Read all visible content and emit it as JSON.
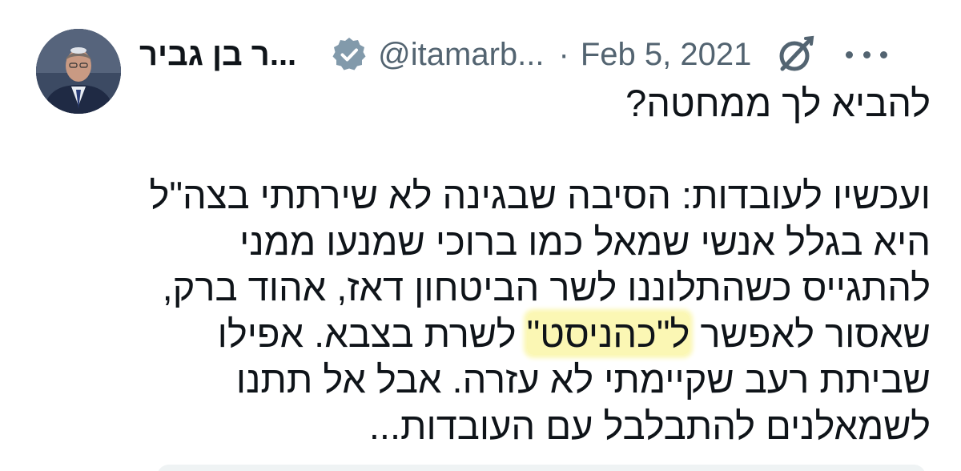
{
  "tweet": {
    "author": {
      "display_name": "...ר בן גביר",
      "handle": "@itamarb...",
      "avatar_icon": "avatar-portrait",
      "verified_icon": "verified-badge-icon",
      "verified_color": "#829aab"
    },
    "separator": "·",
    "date": "Feb 5, 2021",
    "actions": {
      "grok_icon": "grok-icon",
      "more_icon": "more-icon"
    },
    "lines": [
      "להביא לך ממחטה?",
      "",
      "ועכשיו לעובדות: הסיבה שבגינה לא שירתתי בצה\"ל",
      "היא בגלל אנשי שמאל כמו ברוכי שמנעו ממני",
      "להתגייס כשהתלוננו לשר הביטחון דאז, אהוד ברק,"
    ],
    "line6_before": "שאסור לאפשר",
    "line6_highlight": "ל\"כהניסט\"",
    "line6_after": "לשרת בצבא. אפילו",
    "lines_end": [
      "שביתת רעב שקיימתי לא עזרה. אבל אל תתנו",
      "לשמאלנים להתבלבל עם העובדות..."
    ],
    "highlight_color": "#fbf7b4",
    "text_color": "#0f1419",
    "muted_color": "#536471"
  }
}
